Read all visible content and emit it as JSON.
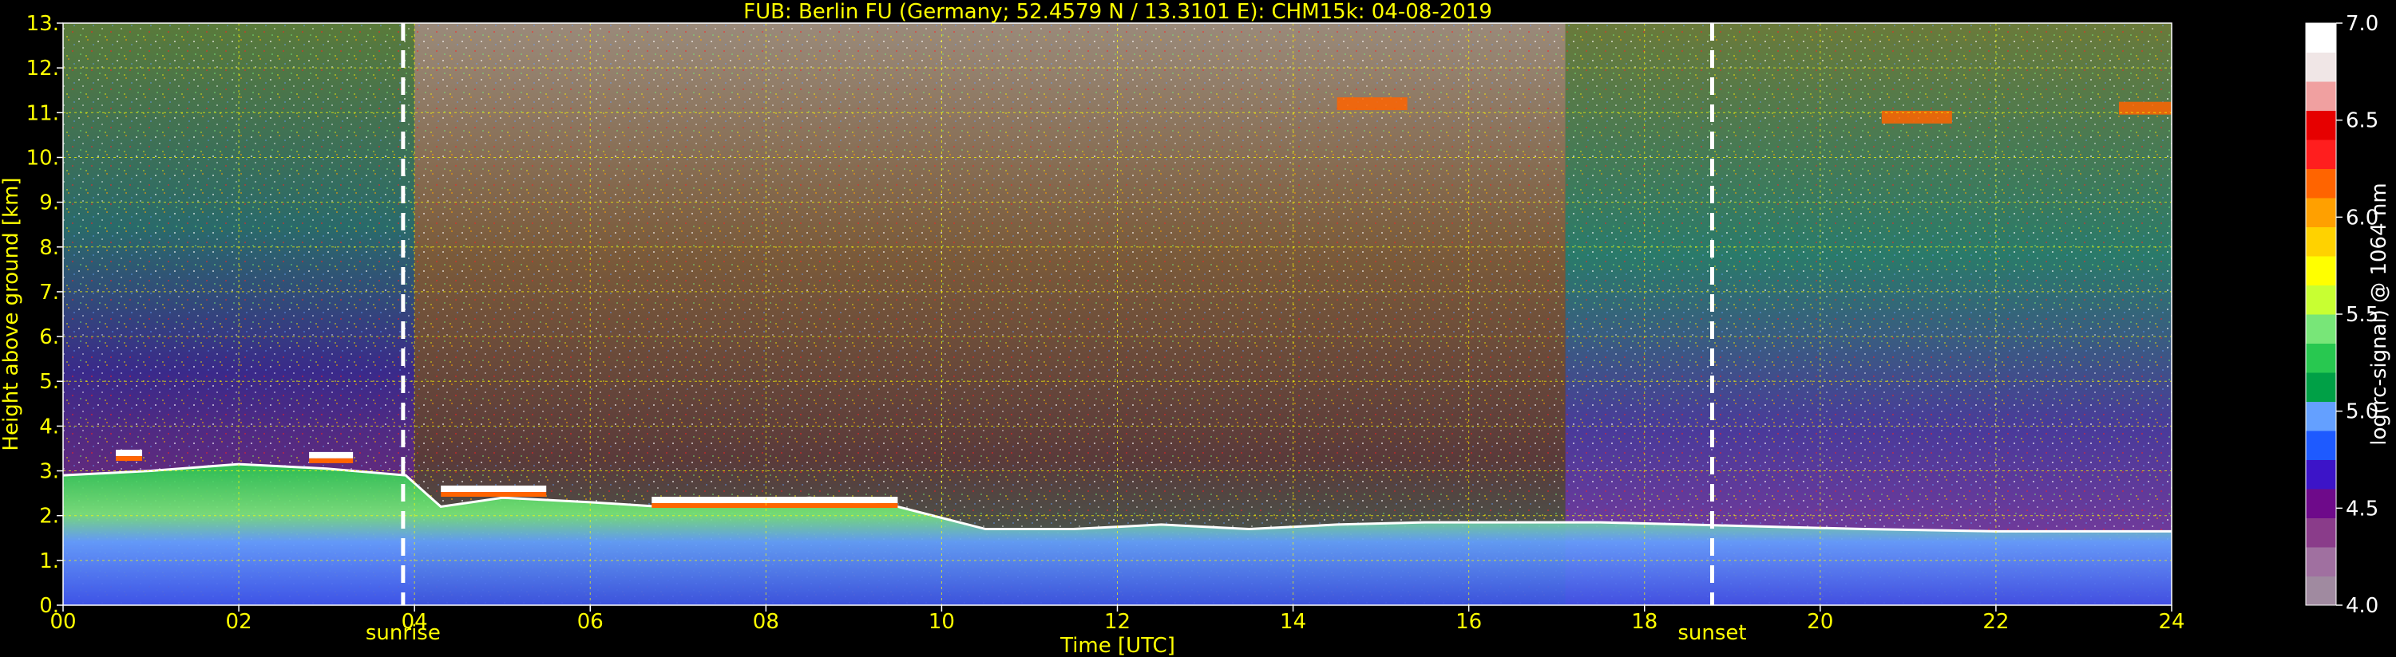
{
  "chart_data": {
    "type": "heatmap",
    "title": "FUB: Berlin FU (Germany; 52.4579 N / 13.3101 E):    CHM15k: 04-08-2019",
    "xlabel": "Time [UTC]",
    "ylabel": "Height above ground [km]",
    "xlim": [
      0,
      24
    ],
    "ylim": [
      0,
      13
    ],
    "x_ticks": [
      "00",
      "02",
      "04",
      "06",
      "08",
      "10",
      "12",
      "14",
      "16",
      "18",
      "20",
      "22",
      "24"
    ],
    "y_ticks": [
      "0.",
      "1.",
      "2.",
      "3.",
      "4.",
      "5.",
      "6.",
      "7.",
      "8.",
      "9.",
      "10.",
      "11.",
      "12.",
      "13."
    ],
    "grid": true,
    "colorbar": {
      "label": "log(rc-signal) @ 1064 nm",
      "range": [
        4.0,
        7.0
      ],
      "ticks": [
        "4.0",
        "4.5",
        "5.0",
        "5.5",
        "6.0",
        "6.5",
        "7.0"
      ],
      "colors": [
        "#a08aa0",
        "#a070a0",
        "#8a3c8a",
        "#6e0a8a",
        "#3c14c8",
        "#1e5aff",
        "#64a0ff",
        "#00a046",
        "#28c850",
        "#78e678",
        "#c8ff32",
        "#ffff00",
        "#ffd200",
        "#ffa000",
        "#ff6400",
        "#ff1e1e",
        "#e60000",
        "#f0a0a0",
        "#f0e6e6",
        "#ffffff"
      ]
    },
    "annotations": [
      {
        "label": "sunrise",
        "x": 3.87
      },
      {
        "label": "sunset",
        "x": 18.77
      }
    ],
    "layers": {
      "boundary_layer_top_km": [
        [
          0,
          2.9
        ],
        [
          1,
          3.0
        ],
        [
          2,
          3.15
        ],
        [
          3,
          3.05
        ],
        [
          3.9,
          2.9
        ],
        [
          4.3,
          2.2
        ],
        [
          5,
          2.4
        ],
        [
          6,
          2.3
        ],
        [
          6.8,
          2.2
        ],
        [
          7.5,
          2.3
        ],
        [
          8.5,
          2.4
        ],
        [
          9.5,
          2.2
        ],
        [
          10.5,
          1.7
        ],
        [
          11.5,
          1.7
        ],
        [
          12.5,
          1.8
        ],
        [
          13.5,
          1.7
        ],
        [
          14.5,
          1.8
        ],
        [
          15.5,
          1.85
        ],
        [
          16.5,
          1.85
        ],
        [
          17.5,
          1.85
        ],
        [
          18.5,
          1.8
        ],
        [
          19.5,
          1.75
        ],
        [
          20.5,
          1.7
        ],
        [
          22,
          1.65
        ],
        [
          24,
          1.65
        ]
      ],
      "elevated_aerosol_layers": [
        {
          "x": [
            0.6,
            0.9
          ],
          "height_km": 3.4
        },
        {
          "x": [
            2.8,
            3.3
          ],
          "height_km": 3.35
        },
        {
          "x": [
            4.3,
            5.5
          ],
          "height_km": 2.6
        },
        {
          "x": [
            6.7,
            9.5
          ],
          "height_km": 2.35
        }
      ],
      "high_cloud_patches": [
        {
          "x": [
            14.5,
            15.3
          ],
          "height_km": 11.2
        },
        {
          "x": [
            20.7,
            21.5
          ],
          "height_km": 10.9
        },
        {
          "x": [
            23.4,
            24
          ],
          "height_km": 11.1
        }
      ]
    }
  }
}
